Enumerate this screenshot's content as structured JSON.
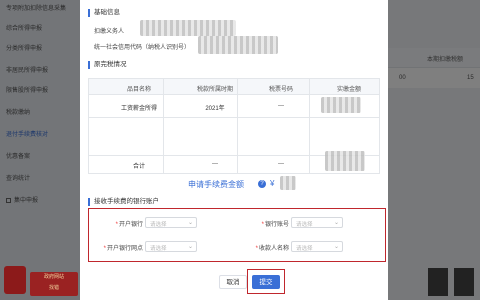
{
  "sidebar": {
    "items": [
      {
        "label": "专项附加扣除信息采集",
        "active": false
      },
      {
        "label": "综合所得申报",
        "active": false
      },
      {
        "label": "分类所得申报",
        "active": false
      },
      {
        "label": "非居民所得申报",
        "active": false
      },
      {
        "label": "限售股所得申报",
        "active": false
      },
      {
        "label": "税款缴纳",
        "active": false
      },
      {
        "label": "退付手续费核对",
        "active": true
      },
      {
        "label": "优惠备案",
        "active": false
      },
      {
        "label": "查询统计",
        "active": false
      },
      {
        "label": "集中申报",
        "active": false
      }
    ]
  },
  "background": {
    "column_header": "本期扣缴税额",
    "cell_value": "15",
    "cell_value_left": "00"
  },
  "footer": {
    "logo_line1": "政府网站",
    "logo_line2": "找错"
  },
  "modal": {
    "basic_info": {
      "title": "基础信息",
      "withholding_agent_label": "扣缴义务人",
      "credit_code_label": "统一社会信用代码（纳税人识别号）"
    },
    "tax_paid": {
      "title": "原完税情况",
      "columns": [
        "品目名称",
        "税款所属时期",
        "税票号码",
        "实缴金额"
      ],
      "rows": [
        {
          "item": "工资薪金所得",
          "period": "2021年",
          "ticket": "---",
          "amount": ""
        }
      ],
      "total": {
        "label": "合计",
        "period": "---",
        "ticket": "---",
        "amount": ""
      }
    },
    "apply_amount_label": "申请手续费金额",
    "apply_amount_value": "¥",
    "bank": {
      "title": "接收手续费的银行账户",
      "fields": [
        {
          "label": "开户银行",
          "placeholder": "请选择"
        },
        {
          "label": "银行账号",
          "placeholder": "请选择"
        },
        {
          "label": "开户银行网点",
          "placeholder": "请选择"
        },
        {
          "label": "收款人名称",
          "placeholder": "请选择"
        }
      ]
    },
    "cancel_label": "取消",
    "submit_label": "提交"
  },
  "colors": {
    "accent": "#3a6fd6",
    "highlight": "#c0272d"
  }
}
